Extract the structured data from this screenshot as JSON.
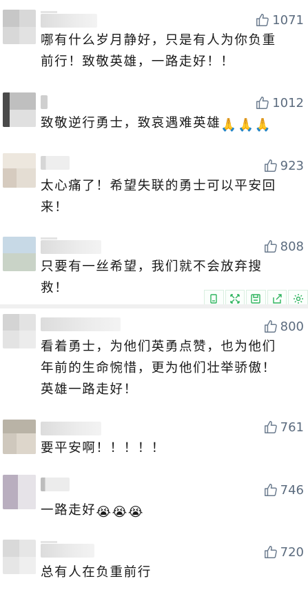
{
  "comments": [
    {
      "likes": "1071",
      "lines": [
        "哪有什么岁月静好，只是有人为你负重",
        "前行！致敬英雄，一路走好！！"
      ],
      "emoji": "",
      "emoji_name": ""
    },
    {
      "likes": "1012",
      "lines": [
        "致敬逆行勇士，致哀遇难英雄"
      ],
      "emoji": "🙏🙏🙏",
      "emoji_name": "praying-hands-icon"
    },
    {
      "likes": "923",
      "lines": [
        "太心痛了！希望失联的勇士可以平安回",
        "来！"
      ],
      "emoji": "",
      "emoji_name": ""
    },
    {
      "likes": "808",
      "lines": [
        "只要有一丝希望，我们就不会放弃搜",
        "救！"
      ],
      "emoji": "",
      "emoji_name": ""
    },
    {
      "likes": "800",
      "lines": [
        "看着勇士，为他们英勇点赞，也为他们",
        "年前的生命惋惜，更为他们壮举骄傲！",
        "英雄一路走好！"
      ],
      "emoji": "",
      "emoji_name": ""
    },
    {
      "likes": "761",
      "lines": [
        "要平安啊！！！！！"
      ],
      "emoji": "",
      "emoji_name": ""
    },
    {
      "likes": "746",
      "lines": [
        "一路走好"
      ],
      "emoji": "😭😭😭",
      "emoji_name": "crying-face-icon"
    },
    {
      "likes": "720",
      "lines": [
        "总有人在负重前行"
      ],
      "emoji": "",
      "emoji_name": ""
    }
  ],
  "toolbar": {
    "icons": [
      "copy-icon",
      "expand-icon",
      "save-icon",
      "share-icon",
      "settings-icon"
    ]
  },
  "colors": {
    "like_color": "#5b6b7e",
    "toolbar_accent": "#2db35d"
  }
}
